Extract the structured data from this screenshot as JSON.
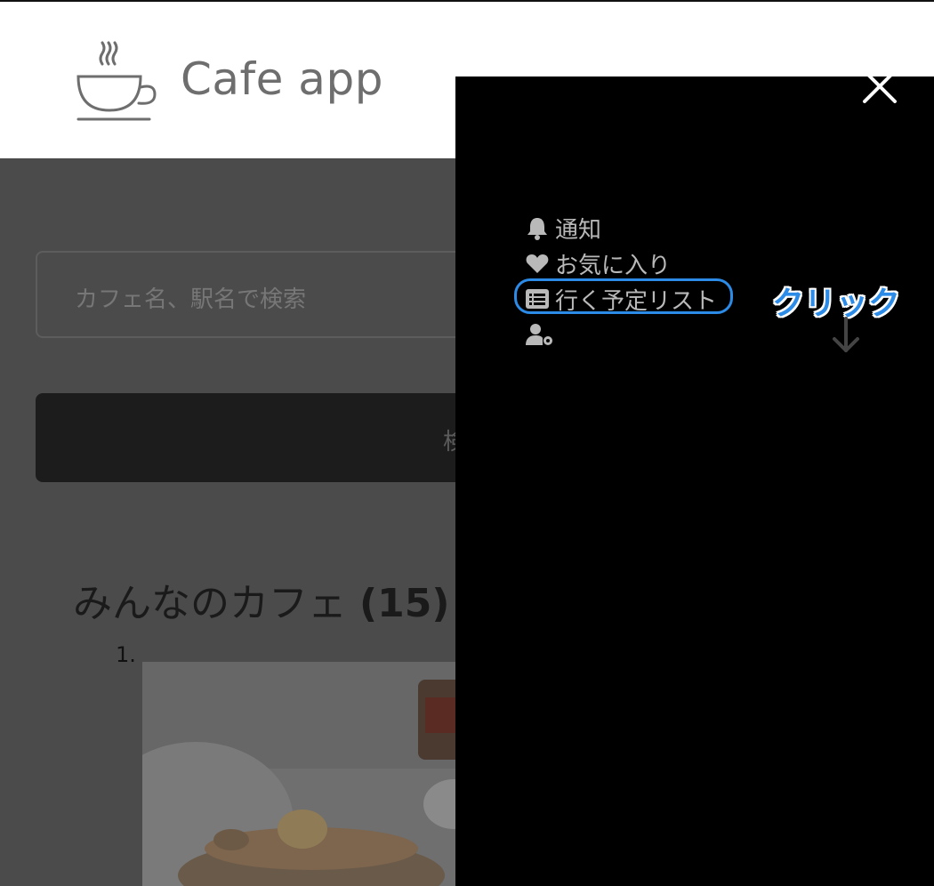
{
  "header": {
    "app_title": "Cafe app",
    "logo_icon": "coffee-cup-icon"
  },
  "search": {
    "placeholder": "カフェ名、駅名で検索",
    "button_label": "検"
  },
  "section": {
    "title_prefix": "みんなのカフェ ",
    "title_count": "(15)"
  },
  "list": {
    "first_number": "1."
  },
  "drawer": {
    "close_icon": "close-icon",
    "menu": [
      {
        "icon": "bell-icon",
        "label": "通知"
      },
      {
        "icon": "heart-icon",
        "label": "お気に入り"
      },
      {
        "icon": "list-icon",
        "label": "行く予定リスト"
      },
      {
        "icon": "user-settings-icon",
        "label": ""
      }
    ],
    "annotation": {
      "label": "クリック",
      "arrow": "down-arrow-icon"
    }
  },
  "colors": {
    "highlight": "#2b8be6",
    "drawer_bg": "#000000",
    "overlay": "#4b4b4b"
  }
}
